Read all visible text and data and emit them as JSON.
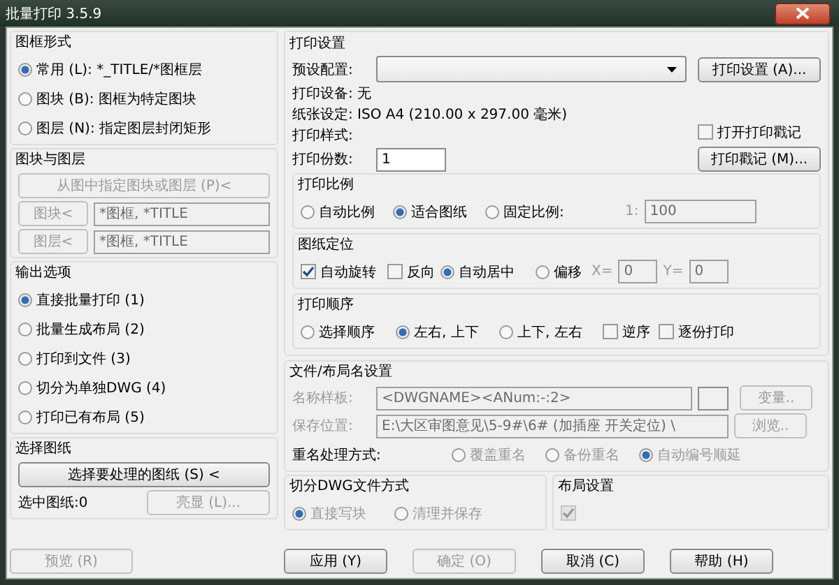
{
  "window": {
    "title": "批量打印 3.5.9"
  },
  "frame_style": {
    "title": "图框形式",
    "options": [
      {
        "label": "常用 (L): *_TITLE/*图框层",
        "selected": true
      },
      {
        "label": "图块 (B): 图框为特定图块",
        "selected": false
      },
      {
        "label": "图层 (N): 指定图层封闭矩形",
        "selected": false
      }
    ]
  },
  "blocks_layers": {
    "title": "图块与图层",
    "pick_button": {
      "label": "从图中指定图块或图层 (P)<",
      "disabled": true
    },
    "rows": [
      {
        "button": {
          "label": "图块<",
          "disabled": true
        },
        "value": "*图框, *TITLE"
      },
      {
        "button": {
          "label": "图层<",
          "disabled": true
        },
        "value": "*图框, *TITLE"
      }
    ]
  },
  "output_options": {
    "title": "输出选项",
    "options": [
      {
        "label": "直接批量打印 (1)",
        "selected": true
      },
      {
        "label": "批量生成布局 (2)",
        "selected": false
      },
      {
        "label": "打印到文件 (3)",
        "selected": false
      },
      {
        "label": "切分为单独DWG (4)",
        "selected": false
      },
      {
        "label": "打印已有布局 (5)",
        "selected": false
      }
    ]
  },
  "select_drawings": {
    "title": "选择图纸",
    "select_button": {
      "label": "选择要处理的图纸 (S) <",
      "disabled": false
    },
    "selected_count": "选中图纸:0",
    "highlight_button": {
      "label": "亮显 (L)...",
      "disabled": true
    }
  },
  "preview_button": {
    "label": "预览 (R)",
    "disabled": true
  },
  "print_settings": {
    "title": "打印设置",
    "preset_label": "预设配置:",
    "setup_button": {
      "label": "打印设置 (A)...",
      "disabled": false
    },
    "device": "打印设备: 无",
    "paper": "纸张设定: ISO A4 (210.00 x 297.00 毫米)",
    "style": "打印样式:",
    "stamp_checkbox": {
      "label": "打开打印戳记",
      "checked": false
    },
    "copies_label": "打印份数:",
    "copies_value": "1",
    "stamp_button": {
      "label": "打印戳记 (M)...",
      "disabled": false
    }
  },
  "scale": {
    "title": "打印比例",
    "options": [
      {
        "label": "自动比例",
        "selected": false
      },
      {
        "label": "适合图纸",
        "selected": true
      },
      {
        "label": "固定比例:",
        "selected": false
      }
    ],
    "ratio_prefix": "1:",
    "ratio_value": "100"
  },
  "placement": {
    "title": "图纸定位",
    "checkboxes": [
      {
        "label": "自动旋转",
        "checked": true
      },
      {
        "label": "反向",
        "checked": false
      }
    ],
    "options": [
      {
        "label": "自动居中",
        "selected": true
      },
      {
        "label": "偏移",
        "selected": false
      }
    ],
    "x_label": "X=",
    "x_value": "0",
    "y_label": "Y=",
    "y_value": "0"
  },
  "order": {
    "title": "打印顺序",
    "options": [
      {
        "label": "选择顺序",
        "selected": false
      },
      {
        "label": "左右, 上下",
        "selected": true
      },
      {
        "label": "上下, 左右",
        "selected": false
      }
    ],
    "checkboxes": [
      {
        "label": "逆序",
        "checked": false
      },
      {
        "label": "逐份打印",
        "checked": false
      }
    ]
  },
  "naming": {
    "title": "文件/布局名设置",
    "template_label": "名称样板:",
    "template_value": "<DWGNAME><ANum:-:2>",
    "variable_button": {
      "label": "变量..",
      "disabled": true
    },
    "location_label": "保存位置:",
    "location_value": "E:\\大区审图意见\\5-9#\\6# (加插座 开关定位) \\",
    "browse_button": {
      "label": "浏览..",
      "disabled": true
    },
    "rename_label": "重名处理方式:",
    "rename_options": [
      {
        "label": "覆盖重名",
        "selected": false
      },
      {
        "label": "备份重名",
        "selected": false
      },
      {
        "label": "自动编号顺延",
        "selected": true
      }
    ]
  },
  "split": {
    "title": "切分DWG文件方式",
    "options": [
      {
        "label": "直接写块",
        "selected": true
      },
      {
        "label": "清理并保存",
        "selected": false
      }
    ]
  },
  "layout_settings": {
    "title": "布局设置",
    "checkbox": {
      "checked": true,
      "disabled": true
    }
  },
  "buttons": [
    {
      "label": "应用 (Y)",
      "disabled": false
    },
    {
      "label": "确定 (O)",
      "disabled": true
    },
    {
      "label": "取消 (C)",
      "disabled": false
    },
    {
      "label": "帮助 (H)",
      "disabled": false
    }
  ]
}
